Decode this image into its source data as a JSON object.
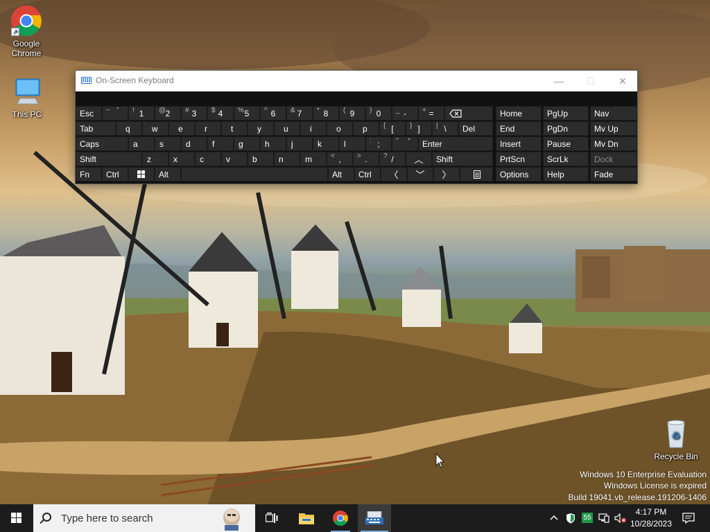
{
  "desktop": {
    "icons": {
      "chrome": "Google Chrome",
      "this_pc": "This PC",
      "recycle_bin": "Recycle Bin"
    },
    "watermark": {
      "line1": "Windows 10 Enterprise Evaluation",
      "line2": "Windows License is expired",
      "line3": "Build 19041.vb_release.191206-1406"
    }
  },
  "osk": {
    "title": "On-Screen Keyboard",
    "window_buttons": {
      "minimize": "—",
      "maximize": "☐",
      "close": "✕"
    },
    "keys": {
      "esc": "Esc",
      "tab": "Tab",
      "caps": "Caps",
      "shift_left": "Shift",
      "fn": "Fn",
      "ctrl_left": "Ctrl",
      "alt_left": "Alt",
      "alt_right": "Alt",
      "ctrl_right": "Ctrl",
      "shift_right": "Shift",
      "del": "Del",
      "enter": "Enter",
      "num_1": "1",
      "num_1_shift": "!",
      "num_2": "2",
      "num_2_shift": "@",
      "num_3": "3",
      "num_3_shift": "#",
      "num_4": "4",
      "num_4_shift": "$",
      "num_5": "5",
      "num_5_shift": "%",
      "num_6": "6",
      "num_6_shift": "^",
      "num_7": "7",
      "num_7_shift": "&",
      "num_8": "8",
      "num_8_shift": "*",
      "num_9": "9",
      "num_9_shift": "(",
      "num_0": "0",
      "num_0_shift": ")",
      "minus": "-",
      "minus_shift": "_",
      "equals": "=",
      "equals_shift": "+",
      "backtick": "`",
      "backtick_shift": "~",
      "q": "q",
      "w": "w",
      "e": "e",
      "r": "r",
      "t": "t",
      "y": "y",
      "u": "u",
      "i": "i",
      "o": "o",
      "p": "p",
      "bracket_l": "[",
      "bracket_l_shift": "{",
      "bracket_r": "]",
      "bracket_r_shift": "}",
      "backslash": "\\",
      "backslash_shift": "|",
      "a": "a",
      "s": "s",
      "d": "d",
      "f": "f",
      "g": "g",
      "h": "h",
      "j": "j",
      "k": "k",
      "l": "l",
      "semicolon": ";",
      "semicolon_shift": ":",
      "quote": "'",
      "quote_shift": "\"",
      "z": "z",
      "x": "x",
      "c": "c",
      "v": "v",
      "b": "b",
      "n": "n",
      "m": "m",
      "comma": ",",
      "comma_shift": "<",
      "period": ".",
      "period_shift": ">",
      "slash": "/",
      "slash_shift": "?",
      "arrow_up": "︿",
      "arrow_down": "﹀",
      "arrow_left": "〈",
      "arrow_right": "〉",
      "win_icon": "windows-icon",
      "menu_icon": "menu-icon",
      "home": "Home",
      "pgup": "PgUp",
      "nav": "Nav",
      "end": "End",
      "pgdn": "PgDn",
      "mvup": "Mv Up",
      "insert": "Insert",
      "pause": "Pause",
      "mvdn": "Mv Dn",
      "prtscn": "PrtScn",
      "scrlk": "ScrLk",
      "dock": "Dock",
      "options": "Options",
      "help": "Help",
      "fade": "Fade"
    }
  },
  "taskbar": {
    "search_placeholder": "Type here to search",
    "tray_badge": "55",
    "time": "4:17 PM",
    "date": "10/28/2023"
  },
  "colors": {
    "taskbar": "#1c1c1c",
    "key": "#2c2c2c",
    "osk_body": "#111111",
    "accent": "#7aaee0"
  }
}
